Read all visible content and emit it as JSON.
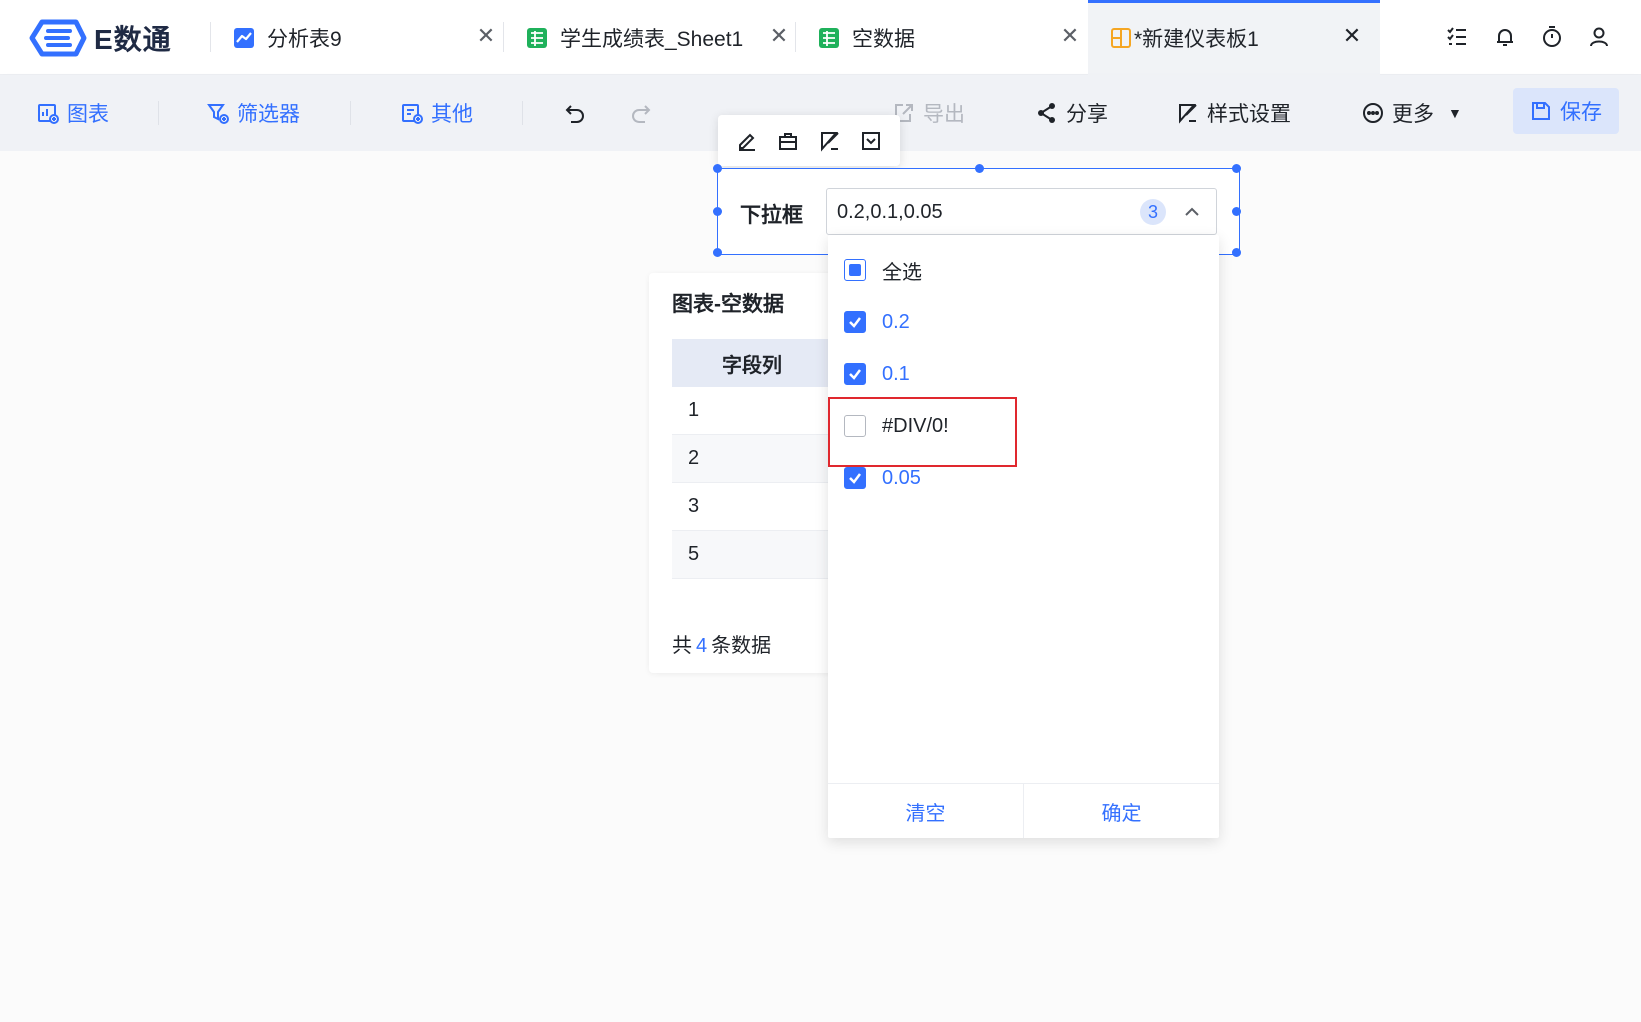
{
  "app": {
    "logo_text": "E数通",
    "brand_color": "#3370ff"
  },
  "tabs": [
    {
      "label": "分析表9",
      "icon": "line-chart-icon",
      "active": false
    },
    {
      "label": "学生成绩表_Sheet1",
      "icon": "spreadsheet-icon",
      "active": false
    },
    {
      "label": "空数据",
      "icon": "spreadsheet-icon",
      "active": false
    },
    {
      "label": "*新建仪表板1",
      "icon": "dashboard-icon",
      "active": true
    }
  ],
  "header_icons": [
    "task-list-icon",
    "bell-icon",
    "timer-icon",
    "user-icon"
  ],
  "toolbar": {
    "chart_label": "图表",
    "filter_label": "筛选器",
    "other_label": "其他",
    "export_label": "导出",
    "share_label": "分享",
    "style_label": "样式设置",
    "more_label": "更多",
    "save_label": "保存"
  },
  "filter": {
    "label": "下拉框",
    "value": "0.2,0.1,0.05",
    "selected_count": "3",
    "options": [
      {
        "label": "全选",
        "state": "partial"
      },
      {
        "label": "0.2",
        "state": "checked"
      },
      {
        "label": "0.1",
        "state": "checked"
      },
      {
        "label": "#DIV/0!",
        "state": "unchecked"
      },
      {
        "label": "0.05",
        "state": "checked"
      }
    ],
    "clear_label": "清空",
    "confirm_label": "确定"
  },
  "chart_card": {
    "title": "图表-空数据",
    "column_header": "字段列",
    "rows": [
      "1",
      "2",
      "3",
      "5"
    ],
    "footer_prefix": "共",
    "footer_count": "4",
    "footer_suffix": "条数据"
  }
}
